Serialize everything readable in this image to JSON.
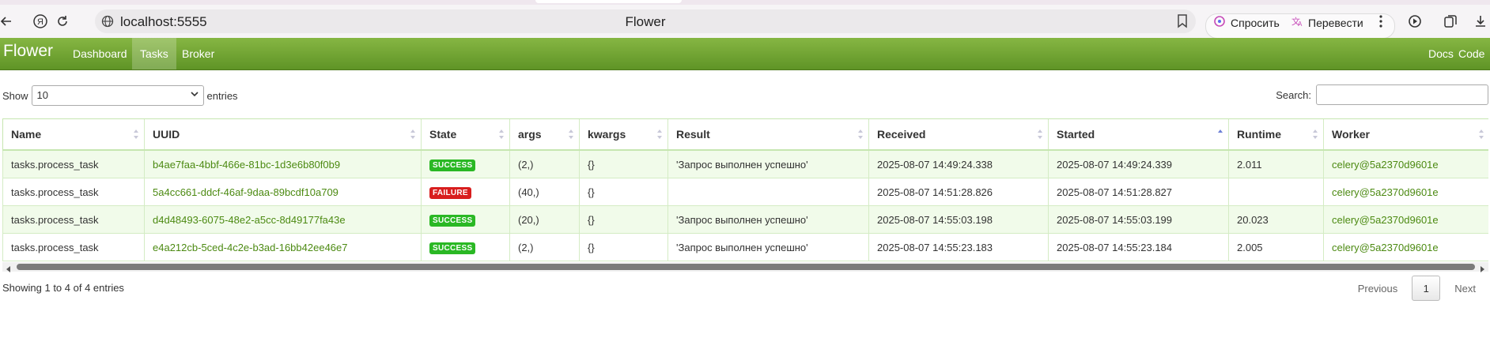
{
  "browser": {
    "url": "localhost:5555",
    "page_title": "Flower",
    "ask_label": "Спросить",
    "translate_label": "Перевести"
  },
  "nav": {
    "brand": "Flower",
    "links": [
      "Dashboard",
      "Tasks",
      "Broker"
    ],
    "active": "Tasks",
    "right_links": [
      "Docs",
      "Code"
    ]
  },
  "controls": {
    "show_label": "Show",
    "entries_value": "10",
    "entries_label": "entries",
    "search_label": "Search:",
    "search_value": ""
  },
  "table": {
    "columns": [
      "Name",
      "UUID",
      "State",
      "args",
      "kwargs",
      "Result",
      "Received",
      "Started",
      "Runtime",
      "Worker"
    ],
    "sorted_column": "Started",
    "sort_direction": "ascending",
    "rows": [
      {
        "name": "tasks.process_task",
        "uuid": "b4ae7faa-4bbf-466e-81bc-1d3e6b80f0b9",
        "state": "SUCCESS",
        "args": "(2,)",
        "kwargs": "{}",
        "result": "'Запрос выполнен успешно'",
        "received": "2025-08-07 14:49:24.338",
        "started": "2025-08-07 14:49:24.339",
        "runtime": "2.011",
        "worker": "celery@5a2370d9601e"
      },
      {
        "name": "tasks.process_task",
        "uuid": "5a4cc661-ddcf-46af-9daa-89bcdf10a709",
        "state": "FAILURE",
        "args": "(40,)",
        "kwargs": "{}",
        "result": "",
        "received": "2025-08-07 14:51:28.826",
        "started": "2025-08-07 14:51:28.827",
        "runtime": "",
        "worker": "celery@5a2370d9601e"
      },
      {
        "name": "tasks.process_task",
        "uuid": "d4d48493-6075-48e2-a5cc-8d49177fa43e",
        "state": "SUCCESS",
        "args": "(20,)",
        "kwargs": "{}",
        "result": "'Запрос выполнен успешно'",
        "received": "2025-08-07 14:55:03.198",
        "started": "2025-08-07 14:55:03.199",
        "runtime": "20.023",
        "worker": "celery@5a2370d9601e"
      },
      {
        "name": "tasks.process_task",
        "uuid": "e4a212cb-5ced-4c2e-b3ad-16bb42ee46e7",
        "state": "SUCCESS",
        "args": "(2,)",
        "kwargs": "{}",
        "result": "'Запрос выполнен успешно'",
        "received": "2025-08-07 14:55:23.183",
        "started": "2025-08-07 14:55:23.184",
        "runtime": "2.005",
        "worker": "celery@5a2370d9601e"
      }
    ]
  },
  "footer": {
    "info": "Showing 1 to 4 of 4 entries",
    "previous": "Previous",
    "current_page": "1",
    "next": "Next"
  },
  "colors": {
    "navbar": "#6fa332",
    "success": "#2ab824",
    "failure": "#d81e1e",
    "link": "#4c8a12",
    "row_stripe": "#f1fbea"
  },
  "icons": [
    "back-icon",
    "yandex-icon",
    "reload-icon",
    "globe-icon",
    "bookmark-icon",
    "ask-icon",
    "translate-icon",
    "more-icon",
    "media-icon",
    "collections-icon",
    "download-icon"
  ]
}
